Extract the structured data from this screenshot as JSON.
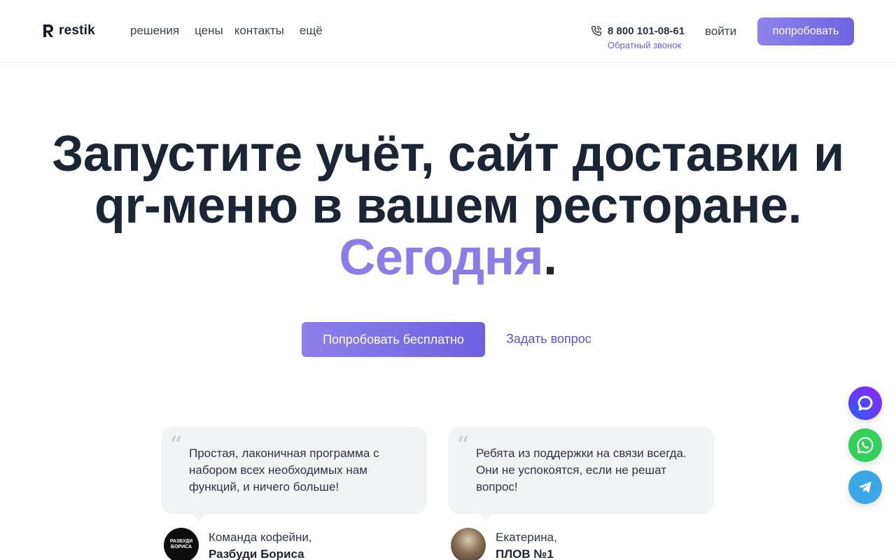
{
  "header": {
    "logo_text": "restik",
    "nav": [
      "решения",
      "цены",
      "контакты",
      "ещё"
    ],
    "phone": "8 800 101-08-61",
    "callback": "Обратный звонок",
    "login": "войти",
    "try_button": "попробовать"
  },
  "hero": {
    "line1": "Запустите учёт, сайт доставки и",
    "line2": "qr-меню в вашем ресторане.",
    "accent": "Сегодня",
    "accent_dot": ".",
    "cta": "Попробовать бесплатно",
    "ask": "Задать вопрос"
  },
  "testimonials": [
    {
      "text": "Простая, лаконичная программа с набором всех необходимых нам функций, и ничего больше!",
      "role": "Команда кофейни,",
      "name": "Разбуди Бориса",
      "avatar_text": "РАЗБУДИ БОРИСА"
    },
    {
      "text": "Ребята из поддержки на связи всегда. Они не успокоятся, если не решат вопрос!",
      "role": "Екатерина,",
      "name": "ПЛОВ №1"
    }
  ],
  "quote_mark": "“",
  "colors": {
    "accent": "#8a7de6",
    "button_gradient_start": "#8d80ea",
    "button_gradient_end": "#6e60e0",
    "text_dark": "#1b2533",
    "whatsapp": "#33d15b",
    "telegram": "#3aa7e6"
  },
  "widgets": [
    "chat-icon",
    "whatsapp-icon",
    "telegram-icon"
  ]
}
